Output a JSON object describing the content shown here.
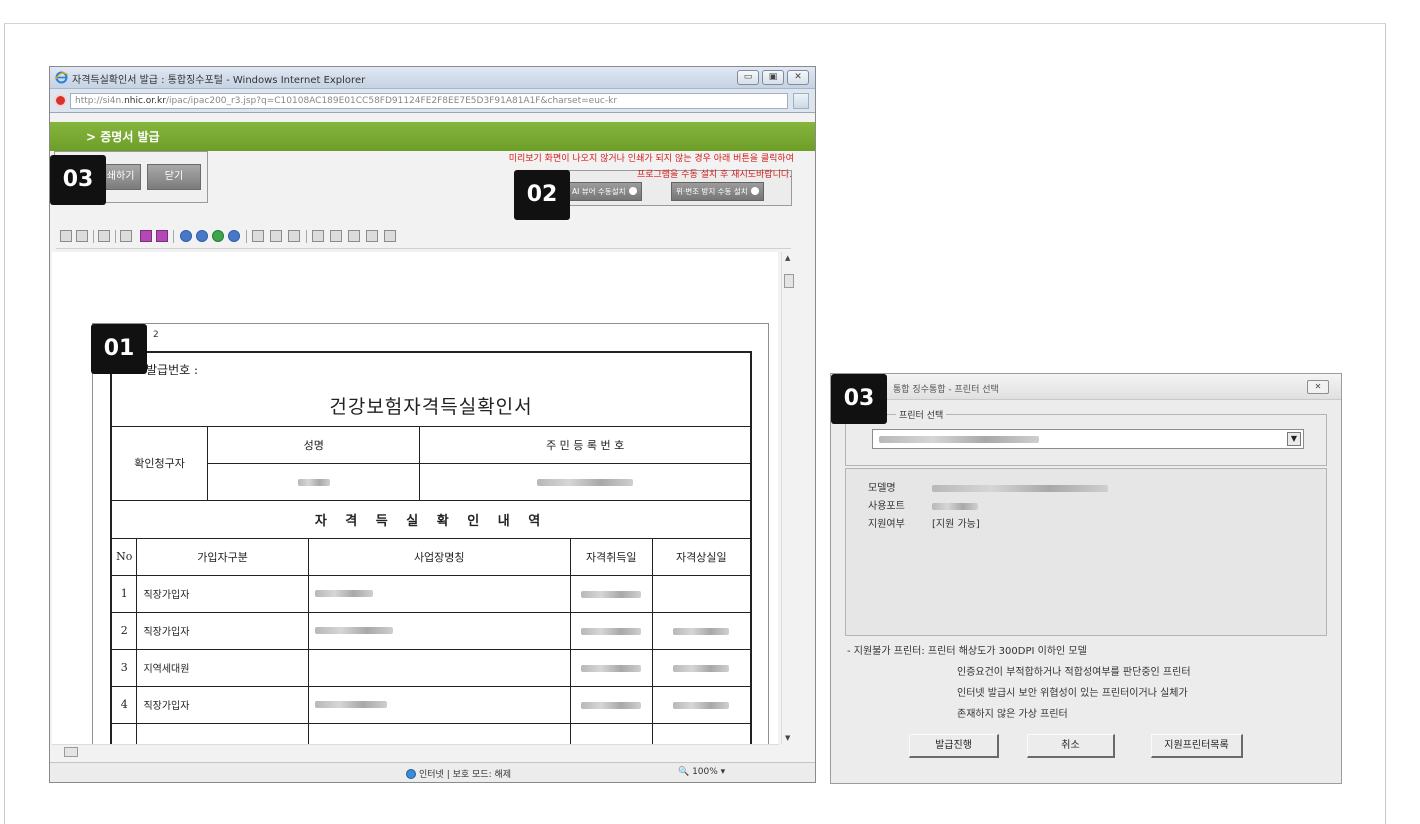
{
  "ie_window": {
    "title": "자격득실확인서 발급 : 통합징수포털 - Windows Internet Explorer",
    "url_prefix": "http://si4n.",
    "url_domain": "nhic.or.kr",
    "url_rest": "/ipac/ipac200_r3.jsp?q=C10108AC189E01CC58FD91124FE2F8EE7E5D3F91A81A1F&charset=euc-kr",
    "window_buttons": [
      "▭",
      "▣",
      "✕"
    ],
    "header_title": "> 증명서 발급",
    "buttons": {
      "print": "인쇄하기",
      "close": "닫기"
    },
    "notice_line1": "미리보기 화면이 나오지 않거나 인쇄가 되지 않는 경우 아래 버튼을 클릭하여",
    "notice_line2": "프로그램을 수동 설치 후 재시도바랍니다.",
    "install_buttons": [
      "AI 뷰어 수동설치",
      "위·변조 방지 수동 설치"
    ],
    "status_zone": "인터넷 | 보호 모드: 해제",
    "status_zoom": "100%",
    "colors": {
      "header_green": "#7aab33",
      "notice_red": "#d21d1d"
    }
  },
  "document": {
    "page_number": "2",
    "issue_no_label": "발급번호 :",
    "title": "건강보험자격득실확인서",
    "confirm_label": "확인청구자",
    "col_name": "성명",
    "col_id": "주 민 등 록 번 호",
    "section_title": "자 격 득 실 확 인 내 역",
    "headers": [
      "No",
      "가입자구분",
      "사업장명칭",
      "자격취득일",
      "자격상실일"
    ],
    "rows": [
      {
        "no": "1",
        "type": "직장가입자"
      },
      {
        "no": "2",
        "type": "직장가입자"
      },
      {
        "no": "3",
        "type": "지역세대원"
      },
      {
        "no": "4",
        "type": "직장가입자"
      }
    ]
  },
  "badges": {
    "doc": "01",
    "install": "02",
    "print": "03",
    "printer": "03"
  },
  "printer_dialog": {
    "title": "통합 징수통합 - 프린터 선택",
    "legend": "프린터 선택",
    "close": "✕",
    "labels": {
      "model": "모델명",
      "port": "사용포트",
      "support": "지원여부"
    },
    "support_value": "[지원 가능]",
    "notes": [
      "- 지원불가 프린터: 프린터 해상도가 300DPI 이하인 모델",
      "인증요건이 부적합하거나 적합성여부를 판단중인 프린터",
      "인터넷 발급시 보안 위협성이 있는 프린터이거나 실체가",
      "존재하지 않은 가상 프린터"
    ],
    "buttons": {
      "proceed": "발급진행",
      "cancel": "취소",
      "list": "지원프린터목록"
    }
  }
}
